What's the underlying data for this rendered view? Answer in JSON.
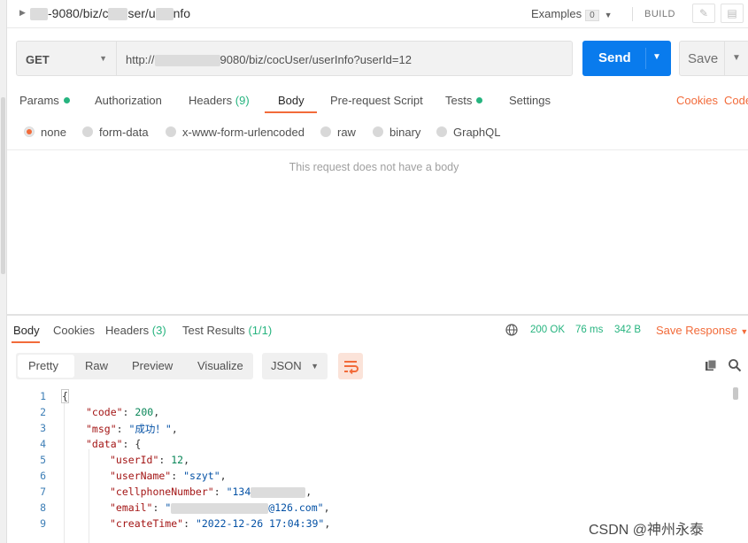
{
  "titlebar": {
    "name_prefix": "-9080/biz/c",
    "name_mid": "ser/u",
    "name_suffix": "nfo",
    "examples_label": "Examples",
    "examples_count": "0",
    "build_label": "BUILD"
  },
  "request": {
    "method": "GET",
    "url_prefix": "http://",
    "url_suffix": "9080/biz/cocUser/userInfo?userId=12",
    "send_label": "Send",
    "save_label": "Save"
  },
  "request_tabs": [
    {
      "label": "Params",
      "dot": true
    },
    {
      "label": "Authorization"
    },
    {
      "label": "Headers",
      "count": "(9)"
    },
    {
      "label": "Body",
      "active": true
    },
    {
      "label": "Pre-request Script"
    },
    {
      "label": "Tests",
      "dot": true
    },
    {
      "label": "Settings"
    }
  ],
  "request_links": {
    "cookies": "Cookies",
    "code": "Code"
  },
  "body_types": [
    "none",
    "form-data",
    "x-www-form-urlencoded",
    "raw",
    "binary",
    "GraphQL"
  ],
  "body_selected": "none",
  "no_body_message": "This request does not have a body",
  "response_tabs": [
    {
      "label": "Body",
      "active": true
    },
    {
      "label": "Cookies"
    },
    {
      "label": "Headers",
      "count": "(3)"
    },
    {
      "label": "Test Results",
      "count": "(1/1)"
    }
  ],
  "response_meta": {
    "status": "200 OK",
    "time": "76 ms",
    "size": "342 B",
    "save_response": "Save Response"
  },
  "view_modes": [
    "Pretty",
    "Raw",
    "Preview",
    "Visualize"
  ],
  "view_active": "Pretty",
  "format": "JSON",
  "code_lines": [
    {
      "n": "1",
      "text": "{"
    },
    {
      "n": "2",
      "key": "\"code\"",
      "value": "200",
      "vtype": "n",
      "trail": ","
    },
    {
      "n": "3",
      "key": "\"msg\"",
      "value": "\"成功！\"",
      "vtype": "s",
      "trail": ","
    },
    {
      "n": "4",
      "key": "\"data\"",
      "value": "{",
      "vtype": "p"
    },
    {
      "n": "5",
      "key": "\"userId\"",
      "value": "12",
      "vtype": "n",
      "trail": ","
    },
    {
      "n": "6",
      "key": "\"userName\"",
      "value": "\"szyt\"",
      "vtype": "s",
      "trail": ","
    },
    {
      "n": "7",
      "key": "\"cellphoneNumber\"",
      "value": "\"134",
      "vtype": "s",
      "trail": ","
    },
    {
      "n": "8",
      "key": "\"email\"",
      "value": "\"@126.com\"",
      "vtype": "s",
      "trail": ","
    },
    {
      "n": "9",
      "key": "\"createTime\"",
      "value": "\"2022-12-26 17:04:39\"",
      "vtype": "s",
      "trail": ","
    }
  ],
  "watermark": "CSDN @神州永泰",
  "colors": {
    "accent": "#f26b3a",
    "send": "#097bed",
    "ok": "#26b47f"
  }
}
